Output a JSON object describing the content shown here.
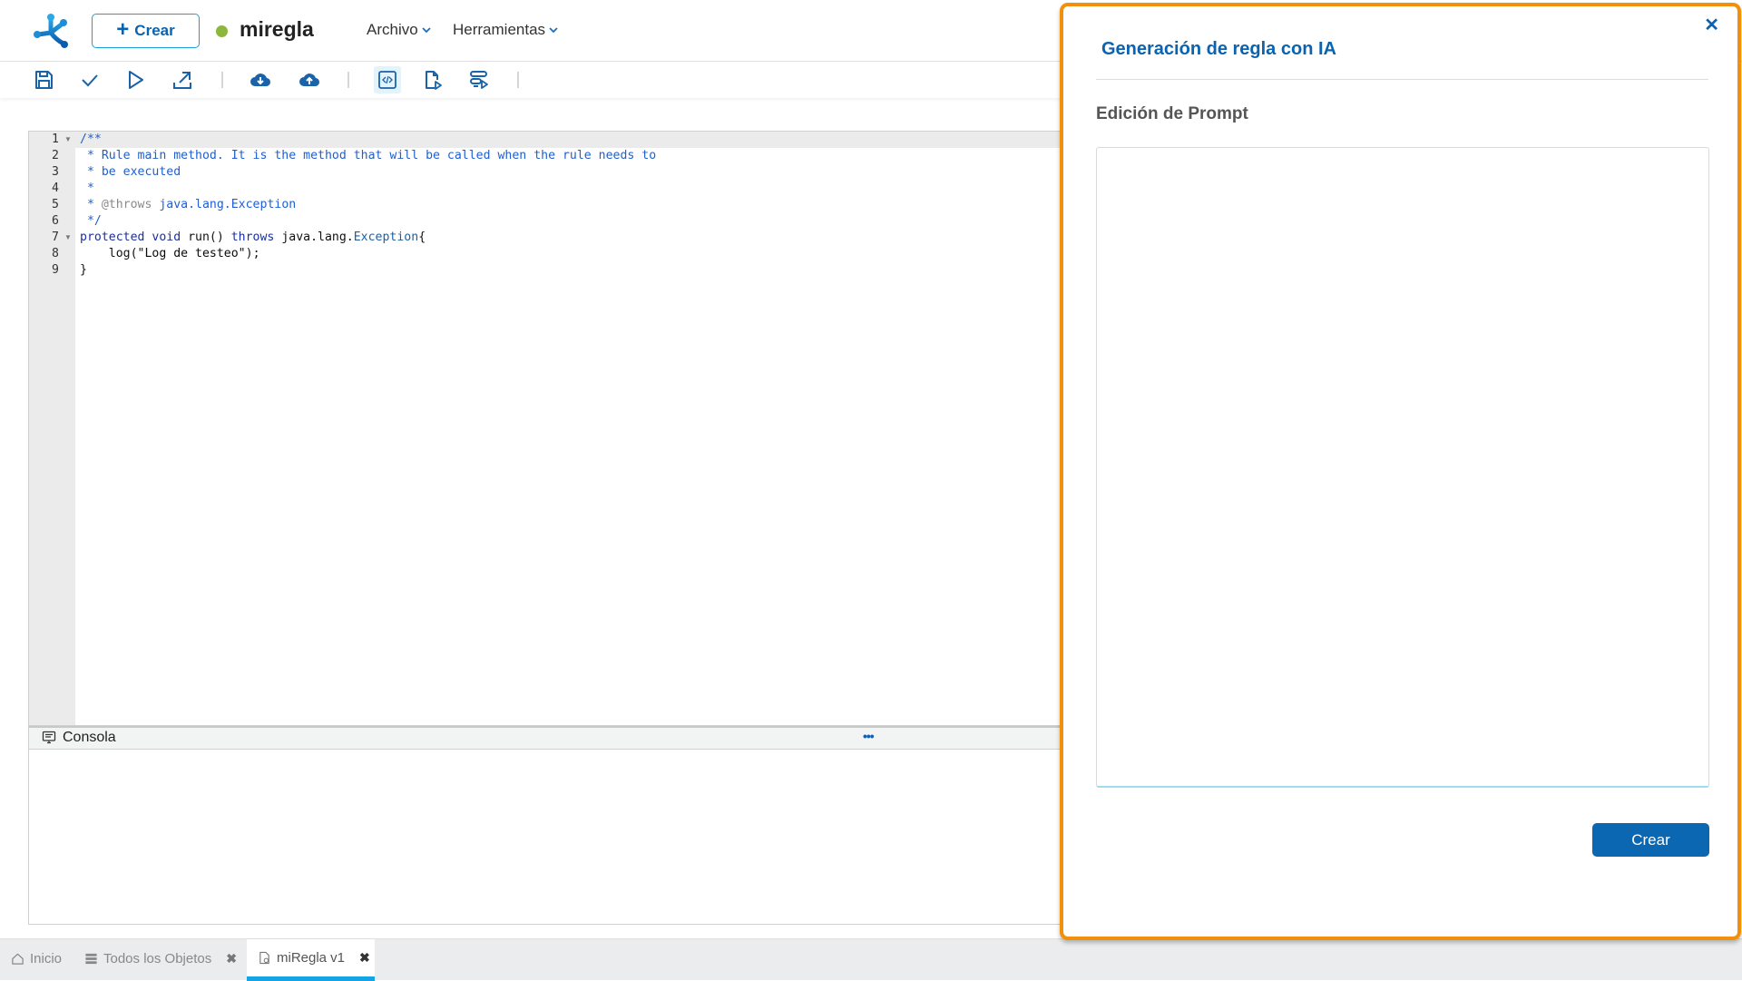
{
  "header": {
    "logo": "app-logo",
    "create_button": "Crear",
    "rule_name": "miregla",
    "status_color": "#8db63c",
    "menus": [
      {
        "label": "Archivo"
      },
      {
        "label": "Herramientas"
      }
    ]
  },
  "toolbar": {
    "buttons": [
      {
        "name": "save",
        "icon": "floppy-disk-icon"
      },
      {
        "name": "validate",
        "icon": "checkmark-icon"
      },
      {
        "name": "run",
        "icon": "play-icon"
      },
      {
        "name": "export",
        "icon": "export-arrow-icon"
      },
      {
        "name": "download",
        "icon": "cloud-download-icon"
      },
      {
        "name": "upload",
        "icon": "cloud-upload-icon"
      },
      {
        "name": "code",
        "icon": "code-icon",
        "active": true
      },
      {
        "name": "run-document",
        "icon": "document-play-icon"
      },
      {
        "name": "run-list",
        "icon": "list-play-icon"
      }
    ]
  },
  "editor": {
    "lines": [
      {
        "n": "1",
        "fold": true,
        "tokens": [
          {
            "t": "/**",
            "c": "comment"
          }
        ]
      },
      {
        "n": "2",
        "fold": false,
        "tokens": [
          {
            "t": " * Rule main method. It is the method that will be called when the rule needs to",
            "c": "comment"
          }
        ]
      },
      {
        "n": "3",
        "fold": false,
        "tokens": [
          {
            "t": " * be executed",
            "c": "comment"
          }
        ]
      },
      {
        "n": "4",
        "fold": false,
        "tokens": [
          {
            "t": " *",
            "c": "comment"
          }
        ]
      },
      {
        "n": "5",
        "fold": false,
        "tokens": [
          {
            "t": " * ",
            "c": "comment"
          },
          {
            "t": "@throws",
            "c": "tag"
          },
          {
            "t": " java.lang.Exception",
            "c": "comment"
          }
        ]
      },
      {
        "n": "6",
        "fold": false,
        "tokens": [
          {
            "t": " */",
            "c": "comment"
          }
        ]
      },
      {
        "n": "7",
        "fold": true,
        "tokens": [
          {
            "t": "protected void ",
            "c": "kw"
          },
          {
            "t": "run() ",
            "c": "plain"
          },
          {
            "t": "throws ",
            "c": "kw"
          },
          {
            "t": "java.lang.",
            "c": "plain"
          },
          {
            "t": "Exception",
            "c": "type"
          },
          {
            "t": "{",
            "c": "plain"
          }
        ]
      },
      {
        "n": "8",
        "fold": false,
        "tokens": [
          {
            "t": "    log(",
            "c": "plain"
          },
          {
            "t": "\"Log de testeo\"",
            "c": "str"
          },
          {
            "t": ");",
            "c": "plain"
          }
        ]
      },
      {
        "n": "9",
        "fold": false,
        "tokens": [
          {
            "t": "}",
            "c": "plain"
          }
        ]
      }
    ]
  },
  "console": {
    "title": "Consola",
    "more": "•••"
  },
  "tabs": [
    {
      "label": "Inicio",
      "icon": "home-icon",
      "closable": false,
      "active": false
    },
    {
      "label": "Todos los Objetos",
      "icon": "list-icon",
      "closable": true,
      "active": false
    },
    {
      "label": "miRegla v1",
      "icon": "rule-document-icon",
      "closable": true,
      "active": true
    }
  ],
  "tab_close_glyph": "✖",
  "ai_panel": {
    "title": "Generación de regla con IA",
    "close_glyph": "✕",
    "subtitle": "Edición de Prompt",
    "prompt_value": "",
    "create_button": "Crear",
    "border_color": "#f0900c"
  }
}
